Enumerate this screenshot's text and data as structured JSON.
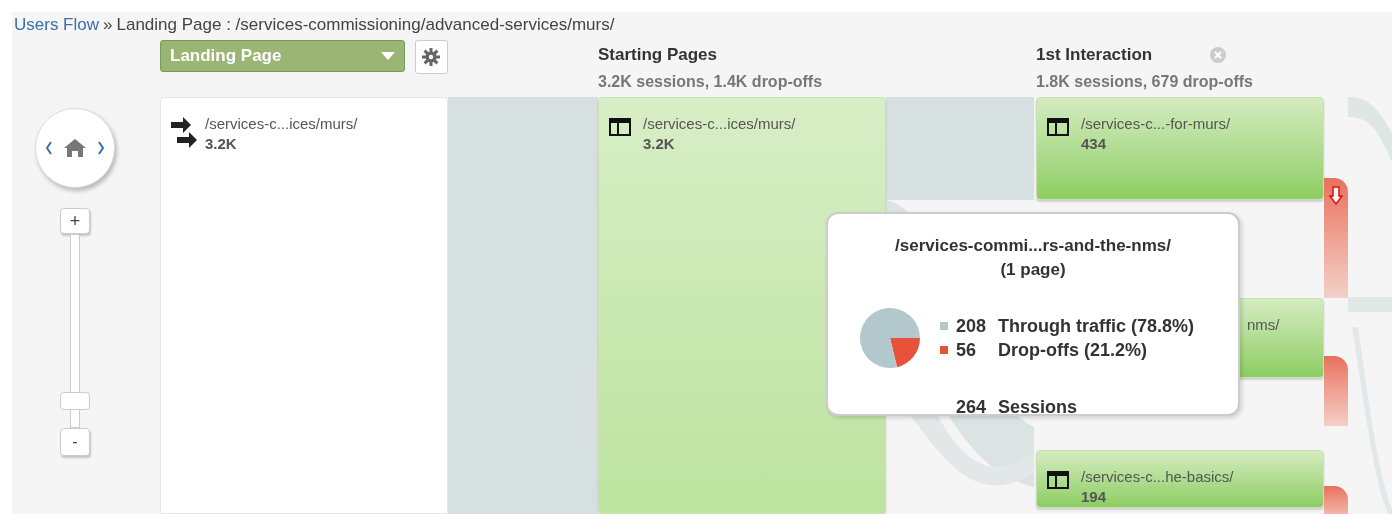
{
  "breadcrumb": {
    "link": "Users Flow",
    "separator": "»",
    "current": "Landing Page : /services-commissioning/advanced-services/murs/"
  },
  "dimension_dropdown": {
    "value": "Landing Page"
  },
  "zoom": {
    "in_label": "+",
    "out_label": "-",
    "level": 0.1
  },
  "columns": [
    {
      "kind": "landing",
      "nodes": [
        {
          "label": "/services-c...ices/murs/",
          "count": "3.2K"
        }
      ]
    },
    {
      "kind": "step",
      "title": "Starting Pages",
      "summary": "3.2K sessions, 1.4K drop-offs",
      "closable": false,
      "nodes": [
        {
          "label": "/services-c...ices/murs/",
          "count": "3.2K",
          "dropoff": false
        }
      ]
    },
    {
      "kind": "step",
      "title": "1st Interaction",
      "summary": "1.8K sessions, 679 drop-offs",
      "closable": true,
      "nodes": [
        {
          "label": "/services-c...-for-murs/",
          "count": "434",
          "dropoff": true,
          "dropoff_arrow": true
        },
        {
          "label": "nms/",
          "dropoff": true
        },
        {
          "label": "/services-c...he-basics/",
          "count": "194",
          "dropoff": true
        }
      ]
    }
  ],
  "tooltip": {
    "title": "/services-commi...rs-and-the-nms/",
    "subtitle": "(1 page)",
    "rows": [
      {
        "value": "208",
        "label": "Through traffic (78.8%)",
        "color": "#b3c8cc"
      },
      {
        "value": "56",
        "label": "Drop-offs (21.2%)",
        "color": "#e8513a"
      }
    ],
    "total": {
      "value": "264",
      "label": "Sessions"
    },
    "chart_data": {
      "type": "pie",
      "values": [
        78.8,
        21.2
      ]
    }
  }
}
